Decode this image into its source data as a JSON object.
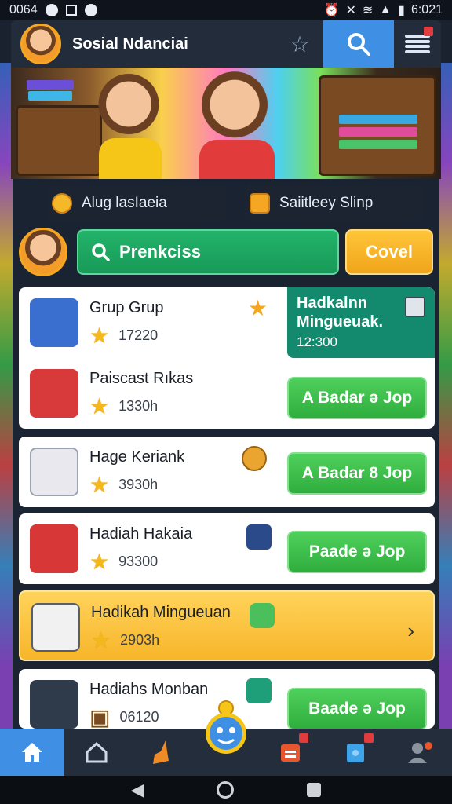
{
  "status_bar": {
    "left_text": "0064",
    "time": "6:021"
  },
  "header": {
    "title": "Sosial Ndanciai"
  },
  "banner": {},
  "info_pills": [
    {
      "label": "Alug lasIaeia",
      "icon": "medal-icon"
    },
    {
      "label": "Saiitleey Slinp",
      "icon": "gift-box-icon"
    }
  ],
  "search": {
    "value": "Prenkciss",
    "action_label": "Covel"
  },
  "items": [
    {
      "title": "Grup Grup",
      "value": "17220",
      "icon": "blue-box-icon"
    },
    {
      "title": "Paiscast Rıkas",
      "value": "1330h",
      "icon": "red-cart-icon",
      "button": "A Badar ə Jop"
    },
    {
      "title": "Hage Keriank",
      "value": "3930h",
      "icon": "gadget-icon",
      "button": "A Badar 8 Jop"
    },
    {
      "title": "Hadiah Hakaia",
      "value": "93300",
      "icon": "red-gift-icon",
      "button": "Paade ə Jop"
    },
    {
      "title": "Hadikah Minguеuan",
      "value": "2903h",
      "icon": "device-icon"
    },
    {
      "title": "Hadiahs Monban",
      "value": "06120",
      "icon": "gaming-kit-icon",
      "button": "Baade ə Jop"
    }
  ],
  "featured_panel": {
    "title": "Hadkalnn Mingueuak.",
    "time": "12:300"
  },
  "bottom_nav": [
    "home-icon",
    "house-outline-icon",
    "broom-icon",
    "mascot-icon",
    "inbox-icon",
    "tablet-icon",
    "profile-icon"
  ],
  "colors": {
    "accent_blue": "#3f8fe5",
    "green": "#2fae3e",
    "teal": "#138a6e",
    "yellow": "#f7b52a"
  }
}
